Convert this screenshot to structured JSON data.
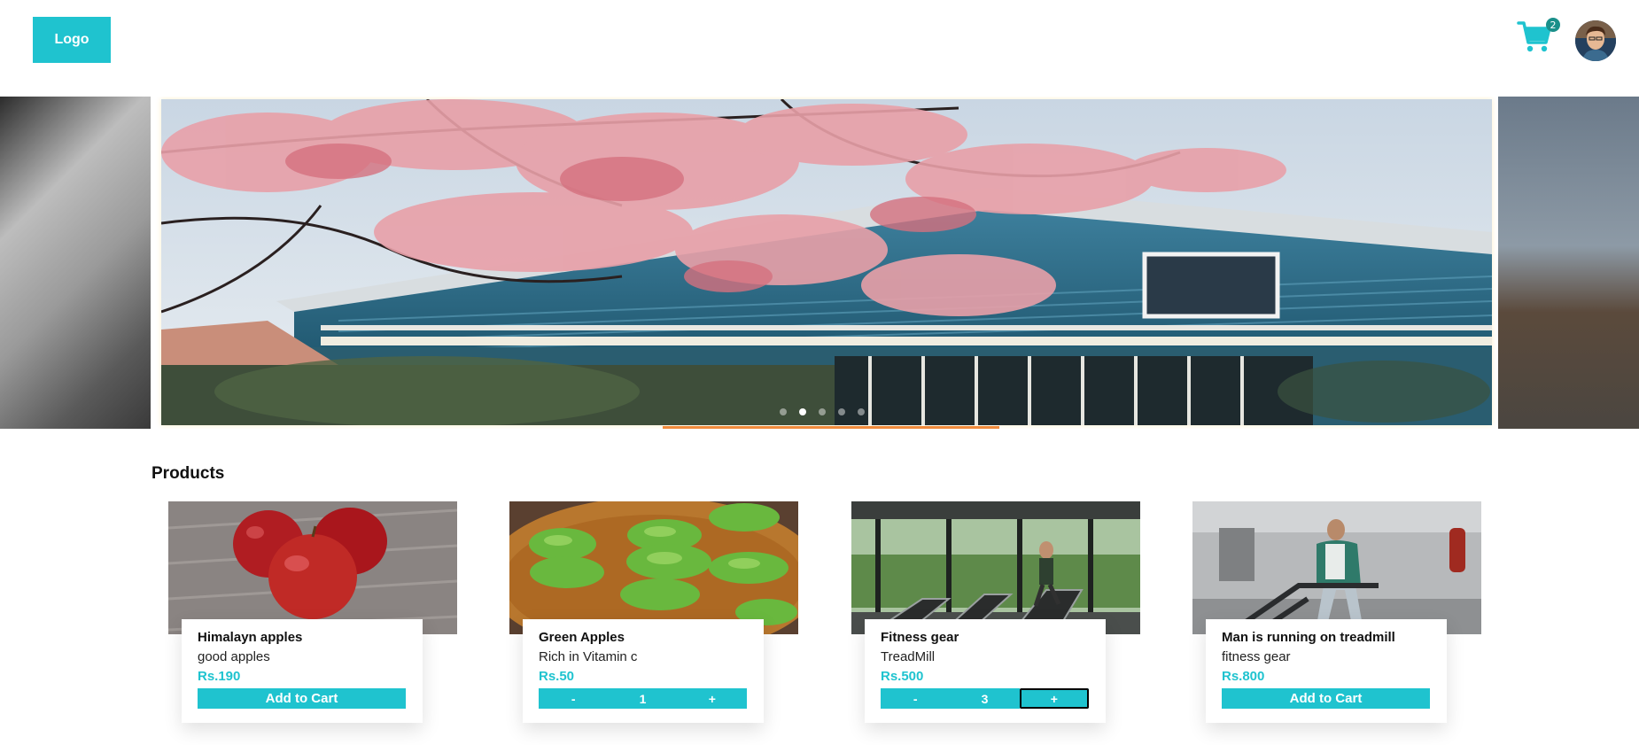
{
  "header": {
    "logo_label": "Logo",
    "cart_count": "2"
  },
  "carousel": {
    "slide_count": 5,
    "active_index": 1
  },
  "products": {
    "title": "Products",
    "items": [
      {
        "name": "Himalayn apples",
        "desc": "good apples",
        "price": "Rs.190",
        "action": "Add to Cart"
      },
      {
        "name": "Green Apples",
        "desc": "Rich in Vitamin c",
        "price": "Rs.50",
        "qty": "1",
        "minus": "-",
        "plus": "+"
      },
      {
        "name": "Fitness gear",
        "desc": "TreadMill",
        "price": "Rs.500",
        "qty": "3",
        "minus": "-",
        "plus": "+"
      },
      {
        "name": "Man is running on treadmill",
        "desc": "fitness gear",
        "price": "Rs.800",
        "action": "Add to Cart"
      }
    ]
  },
  "colors": {
    "accent": "#1fc3cf",
    "badge": "#1a8f8a",
    "progress": "#f08a3c"
  }
}
